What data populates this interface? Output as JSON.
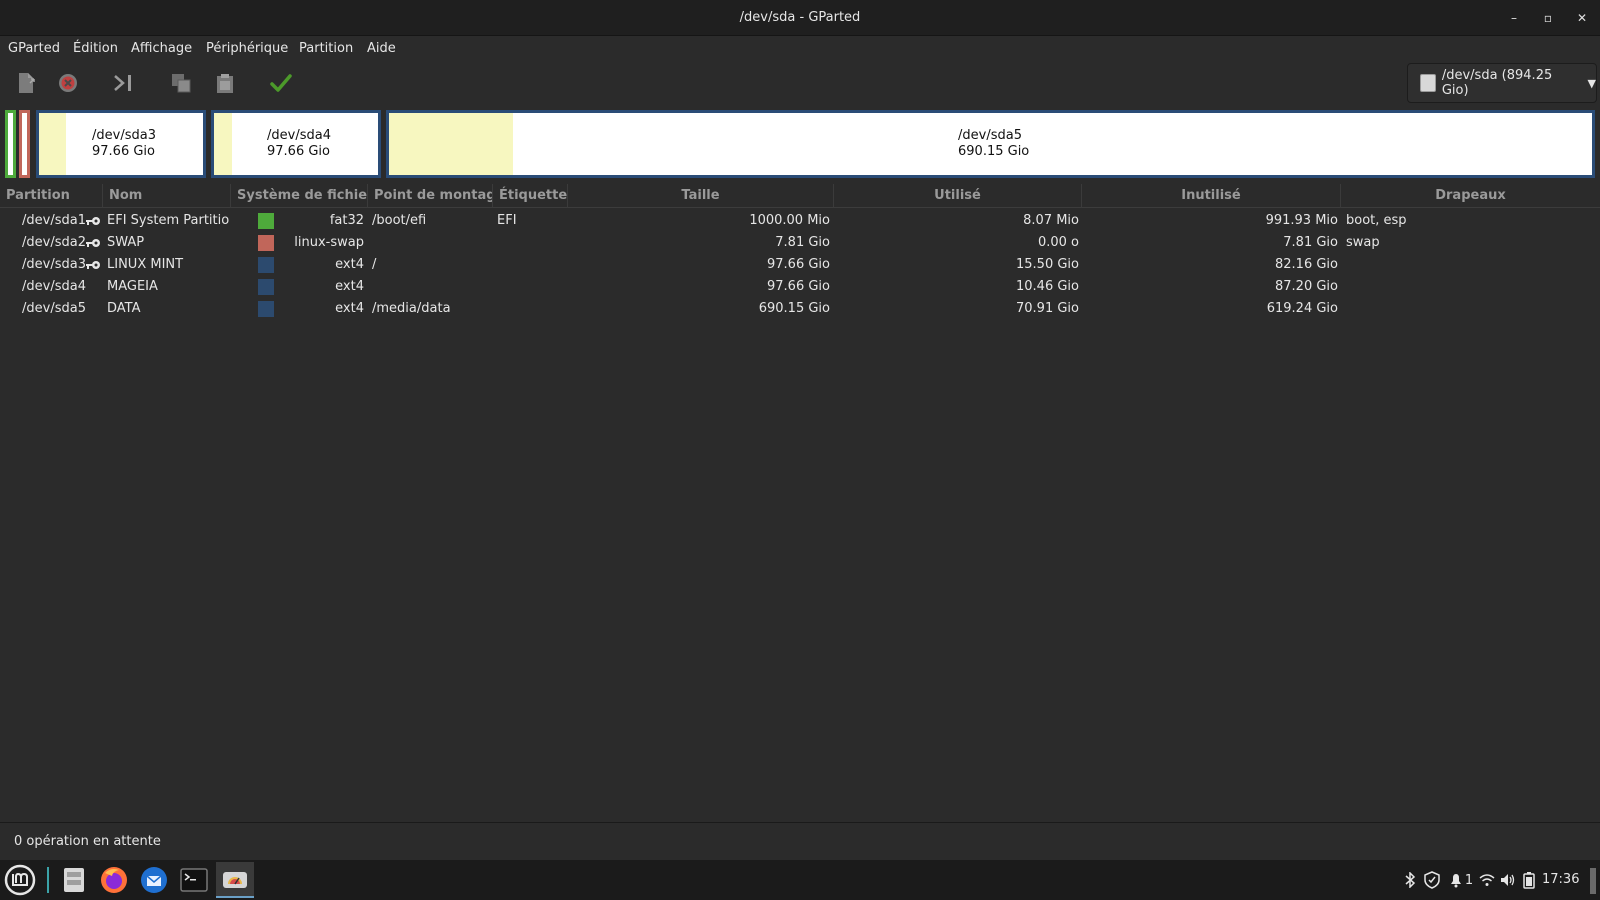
{
  "window": {
    "title": "/dev/sda - GParted",
    "controls": {
      "minimize": "–",
      "maximize": "▫",
      "close": "✕"
    }
  },
  "menubar": {
    "items": [
      "GParted",
      "Édition",
      "Affichage",
      "Périphérique",
      "Partition",
      "Aide"
    ]
  },
  "toolbar": {
    "buttons": [
      "new-partition-icon",
      "delete-icon",
      "resize-move-icon",
      "copy-icon",
      "paste-icon",
      "apply-icon"
    ],
    "device_selector": "/dev/sda (894.25 Gio)",
    "colors": {
      "apply": "#4c9a2a",
      "delete": "#c04040"
    }
  },
  "diskmap": {
    "partitions": [
      {
        "name": "/dev/sda3",
        "size": "97.66 Gio",
        "used_fraction": 0.16
      },
      {
        "name": "/dev/sda4",
        "size": "97.66 Gio",
        "used_fraction": 0.11
      },
      {
        "name": "/dev/sda5",
        "size": "690.15 Gio",
        "used_fraction": 0.1
      }
    ],
    "border_color": "#2a4c77",
    "used_color": "#f7f7c0"
  },
  "table": {
    "headers": [
      "Partition",
      "Nom",
      "Système de fichiers",
      "Point de montage",
      "Étiquette",
      "Taille",
      "Utilisé",
      "Inutilisé",
      "Drapeaux"
    ],
    "rows": [
      {
        "partition": "/dev/sda1",
        "key": true,
        "name": "EFI System Partition",
        "fs_color": "#4eaa3b",
        "fs": "fat32",
        "mount": "/boot/efi",
        "label": "EFI",
        "size": "1000.00 Mio",
        "used": "8.07 Mio",
        "unused": "991.93 Mio",
        "flags": "boot, esp"
      },
      {
        "partition": "/dev/sda2",
        "key": true,
        "name": "SWAP",
        "fs_color": "#c1665a",
        "fs": "linux-swap",
        "mount": "",
        "label": "",
        "size": "7.81 Gio",
        "used": "0.00 o",
        "unused": "7.81 Gio",
        "flags": "swap"
      },
      {
        "partition": "/dev/sda3",
        "key": true,
        "name": "LINUX MINT",
        "fs_color": "#2c4a6e",
        "fs": "ext4",
        "mount": "/",
        "label": "",
        "size": "97.66 Gio",
        "used": "15.50 Gio",
        "unused": "82.16 Gio",
        "flags": ""
      },
      {
        "partition": "/dev/sda4",
        "key": false,
        "name": "MAGEIA",
        "fs_color": "#2c4a6e",
        "fs": "ext4",
        "mount": "",
        "label": "",
        "size": "97.66 Gio",
        "used": "10.46 Gio",
        "unused": "87.20 Gio",
        "flags": ""
      },
      {
        "partition": "/dev/sda5",
        "key": false,
        "name": "DATA",
        "fs_color": "#2c4a6e",
        "fs": "ext4",
        "mount": "/media/data",
        "label": "",
        "size": "690.15 Gio",
        "used": "70.91 Gio",
        "unused": "619.24 Gio",
        "flags": ""
      }
    ]
  },
  "statusbar": {
    "text": "0 opération en attente"
  },
  "taskbar": {
    "apps": [
      "mint-menu-icon",
      "files-icon",
      "firefox-icon",
      "thunderbird-icon",
      "terminal-icon",
      "gparted-icon"
    ],
    "tray": {
      "notifications": "1"
    },
    "clock": "17:36"
  }
}
